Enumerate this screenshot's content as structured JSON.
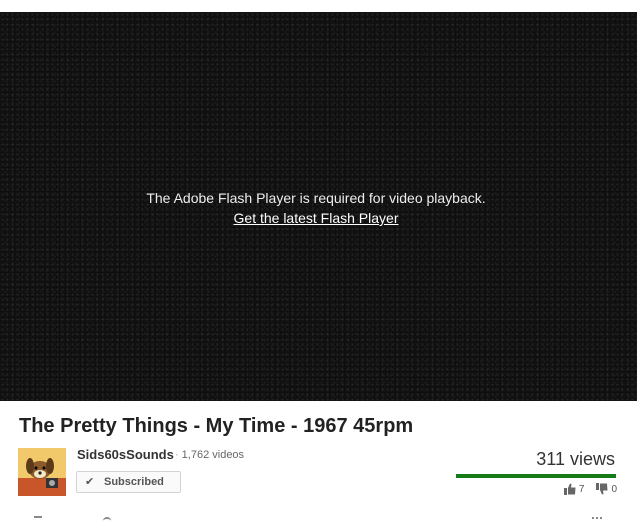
{
  "player": {
    "message": "The Adobe Flash Player is required for video playback.",
    "link_text": "Get the latest Flash Player"
  },
  "video": {
    "title": "The Pretty Things - My Time - 1967 45rpm",
    "views": "311 views",
    "likes": "7",
    "dislikes": "0",
    "like_ratio": 1.0
  },
  "channel": {
    "name": "Sids60sSounds",
    "video_count": "1,762 videos",
    "subscribe_label": "Subscribed"
  },
  "icons": {
    "subscribed_check": "check-icon",
    "like": "thumbs-up-icon",
    "dislike": "thumbs-down-icon"
  },
  "colors": {
    "player_bg": "#141414",
    "ratio_like": "#167a16",
    "ratio_bg": "#cccccc"
  }
}
